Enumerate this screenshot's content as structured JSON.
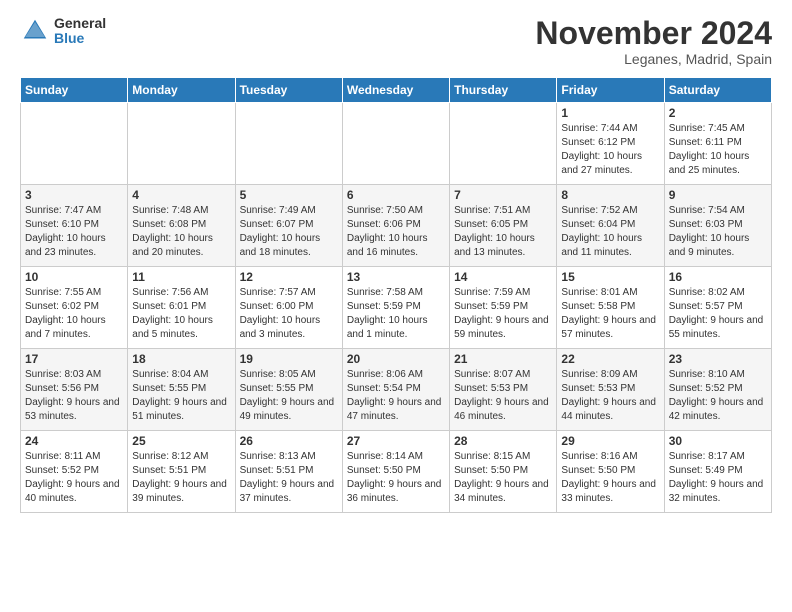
{
  "logo": {
    "general": "General",
    "blue": "Blue"
  },
  "title": "November 2024",
  "location": "Leganes, Madrid, Spain",
  "days_header": [
    "Sunday",
    "Monday",
    "Tuesday",
    "Wednesday",
    "Thursday",
    "Friday",
    "Saturday"
  ],
  "weeks": [
    [
      {
        "day": "",
        "info": ""
      },
      {
        "day": "",
        "info": ""
      },
      {
        "day": "",
        "info": ""
      },
      {
        "day": "",
        "info": ""
      },
      {
        "day": "",
        "info": ""
      },
      {
        "day": "1",
        "info": "Sunrise: 7:44 AM\nSunset: 6:12 PM\nDaylight: 10 hours and 27 minutes."
      },
      {
        "day": "2",
        "info": "Sunrise: 7:45 AM\nSunset: 6:11 PM\nDaylight: 10 hours and 25 minutes."
      }
    ],
    [
      {
        "day": "3",
        "info": "Sunrise: 7:47 AM\nSunset: 6:10 PM\nDaylight: 10 hours and 23 minutes."
      },
      {
        "day": "4",
        "info": "Sunrise: 7:48 AM\nSunset: 6:08 PM\nDaylight: 10 hours and 20 minutes."
      },
      {
        "day": "5",
        "info": "Sunrise: 7:49 AM\nSunset: 6:07 PM\nDaylight: 10 hours and 18 minutes."
      },
      {
        "day": "6",
        "info": "Sunrise: 7:50 AM\nSunset: 6:06 PM\nDaylight: 10 hours and 16 minutes."
      },
      {
        "day": "7",
        "info": "Sunrise: 7:51 AM\nSunset: 6:05 PM\nDaylight: 10 hours and 13 minutes."
      },
      {
        "day": "8",
        "info": "Sunrise: 7:52 AM\nSunset: 6:04 PM\nDaylight: 10 hours and 11 minutes."
      },
      {
        "day": "9",
        "info": "Sunrise: 7:54 AM\nSunset: 6:03 PM\nDaylight: 10 hours and 9 minutes."
      }
    ],
    [
      {
        "day": "10",
        "info": "Sunrise: 7:55 AM\nSunset: 6:02 PM\nDaylight: 10 hours and 7 minutes."
      },
      {
        "day": "11",
        "info": "Sunrise: 7:56 AM\nSunset: 6:01 PM\nDaylight: 10 hours and 5 minutes."
      },
      {
        "day": "12",
        "info": "Sunrise: 7:57 AM\nSunset: 6:00 PM\nDaylight: 10 hours and 3 minutes."
      },
      {
        "day": "13",
        "info": "Sunrise: 7:58 AM\nSunset: 5:59 PM\nDaylight: 10 hours and 1 minute."
      },
      {
        "day": "14",
        "info": "Sunrise: 7:59 AM\nSunset: 5:59 PM\nDaylight: 9 hours and 59 minutes."
      },
      {
        "day": "15",
        "info": "Sunrise: 8:01 AM\nSunset: 5:58 PM\nDaylight: 9 hours and 57 minutes."
      },
      {
        "day": "16",
        "info": "Sunrise: 8:02 AM\nSunset: 5:57 PM\nDaylight: 9 hours and 55 minutes."
      }
    ],
    [
      {
        "day": "17",
        "info": "Sunrise: 8:03 AM\nSunset: 5:56 PM\nDaylight: 9 hours and 53 minutes."
      },
      {
        "day": "18",
        "info": "Sunrise: 8:04 AM\nSunset: 5:55 PM\nDaylight: 9 hours and 51 minutes."
      },
      {
        "day": "19",
        "info": "Sunrise: 8:05 AM\nSunset: 5:55 PM\nDaylight: 9 hours and 49 minutes."
      },
      {
        "day": "20",
        "info": "Sunrise: 8:06 AM\nSunset: 5:54 PM\nDaylight: 9 hours and 47 minutes."
      },
      {
        "day": "21",
        "info": "Sunrise: 8:07 AM\nSunset: 5:53 PM\nDaylight: 9 hours and 46 minutes."
      },
      {
        "day": "22",
        "info": "Sunrise: 8:09 AM\nSunset: 5:53 PM\nDaylight: 9 hours and 44 minutes."
      },
      {
        "day": "23",
        "info": "Sunrise: 8:10 AM\nSunset: 5:52 PM\nDaylight: 9 hours and 42 minutes."
      }
    ],
    [
      {
        "day": "24",
        "info": "Sunrise: 8:11 AM\nSunset: 5:52 PM\nDaylight: 9 hours and 40 minutes."
      },
      {
        "day": "25",
        "info": "Sunrise: 8:12 AM\nSunset: 5:51 PM\nDaylight: 9 hours and 39 minutes."
      },
      {
        "day": "26",
        "info": "Sunrise: 8:13 AM\nSunset: 5:51 PM\nDaylight: 9 hours and 37 minutes."
      },
      {
        "day": "27",
        "info": "Sunrise: 8:14 AM\nSunset: 5:50 PM\nDaylight: 9 hours and 36 minutes."
      },
      {
        "day": "28",
        "info": "Sunrise: 8:15 AM\nSunset: 5:50 PM\nDaylight: 9 hours and 34 minutes."
      },
      {
        "day": "29",
        "info": "Sunrise: 8:16 AM\nSunset: 5:50 PM\nDaylight: 9 hours and 33 minutes."
      },
      {
        "day": "30",
        "info": "Sunrise: 8:17 AM\nSunset: 5:49 PM\nDaylight: 9 hours and 32 minutes."
      }
    ]
  ]
}
